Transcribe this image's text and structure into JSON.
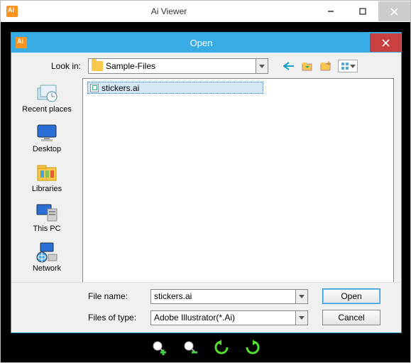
{
  "mainWindow": {
    "title": "Ai Viewer"
  },
  "dialog": {
    "title": "Open",
    "lookInLabel": "Look in:",
    "lookInValue": "Sample-Files",
    "places": [
      {
        "id": "recent",
        "label": "Recent places"
      },
      {
        "id": "desktop",
        "label": "Desktop"
      },
      {
        "id": "libraries",
        "label": "Libraries"
      },
      {
        "id": "thispc",
        "label": "This PC"
      },
      {
        "id": "network",
        "label": "Network"
      }
    ],
    "files": [
      {
        "name": "stickers.ai"
      }
    ],
    "fileNameLabel": "File name:",
    "fileNameValue": "stickers.ai",
    "fileTypeLabel": "Files of type:",
    "fileTypeValue": "Adobe Illustrator(*.Ai)",
    "openButton": "Open",
    "cancelButton": "Cancel"
  }
}
